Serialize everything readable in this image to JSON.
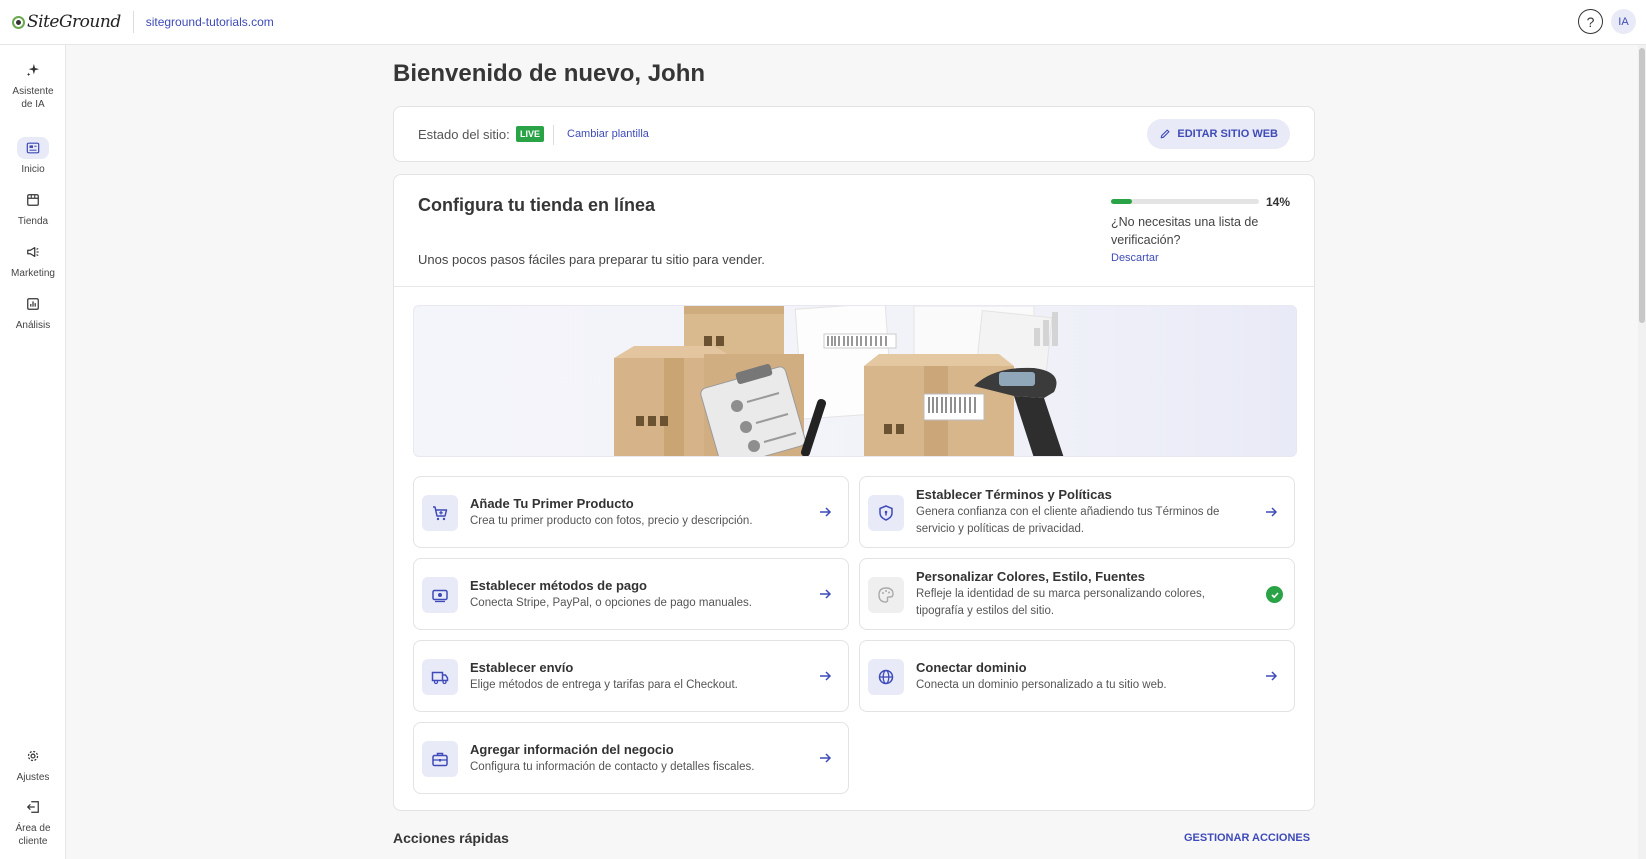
{
  "topbar": {
    "logo_text": "SiteGround",
    "domain": "siteground-tutorials.com",
    "help_label": "?",
    "avatar_initials": "IA"
  },
  "sidebar": {
    "items": [
      {
        "label_line1": "Asistente",
        "label_line2": "de IA",
        "icon": "sparkle-icon"
      },
      {
        "label_line1": "Inicio",
        "label_line2": "",
        "icon": "dashboard-icon",
        "active": true
      },
      {
        "label_line1": "Tienda",
        "label_line2": "",
        "icon": "store-icon"
      },
      {
        "label_line1": "Marketing",
        "label_line2": "",
        "icon": "megaphone-icon"
      },
      {
        "label_line1": "Análisis",
        "label_line2": "",
        "icon": "chart-icon"
      },
      {
        "label_line1": "Ajustes",
        "label_line2": "",
        "icon": "gear-icon"
      },
      {
        "label_line1": "Área de",
        "label_line2": "cliente",
        "icon": "exit-icon"
      }
    ]
  },
  "main": {
    "welcome": "Bienvenido de nuevo, John",
    "status": {
      "label": "Estado del sitio:",
      "badge": "LIVE",
      "change_template": "Cambiar plantilla",
      "edit_button": "EDITAR SITIO WEB"
    },
    "setup": {
      "title": "Configura tu tienda en línea",
      "description": "Unos pocos pasos fáciles para preparar tu sitio para vender.",
      "progress_percent": 14,
      "progress_label": "14%",
      "no_need": "¿No necesitas una lista de verificación?",
      "dismiss": "Descartar",
      "tasks": [
        {
          "title": "Añade Tu Primer Producto",
          "description": "Crea tu primer producto con fotos, precio y descripción.",
          "icon": "cart-icon",
          "done": false
        },
        {
          "title": "Establecer Términos y Políticas",
          "description": "Genera confianza con el cliente añadiendo tus Términos de servicio y políticas de privacidad.",
          "icon": "shield-icon",
          "done": false
        },
        {
          "title": "Establecer métodos de pago",
          "description": "Conecta Stripe, PayPal, o opciones de pago manuales.",
          "icon": "money-icon",
          "done": false
        },
        {
          "title": "Personalizar Colores, Estilo, Fuentes",
          "description": "Refleje la identidad de su marca personalizando colores, tipografía y estilos del sitio.",
          "icon": "palette-icon",
          "done": true
        },
        {
          "title": "Establecer envío",
          "description": "Elige métodos de entrega y tarifas para el Checkout.",
          "icon": "truck-icon",
          "done": false
        },
        {
          "title": "Conectar dominio",
          "description": "Conecta un dominio personalizado a tu sitio web.",
          "icon": "globe-icon",
          "done": false
        },
        {
          "title": "Agregar información del negocio",
          "description": "Configura tu información de contacto y detalles fiscales.",
          "icon": "briefcase-icon",
          "done": false
        }
      ]
    },
    "quick_actions": {
      "title": "Acciones rápidas",
      "manage": "GESTIONAR ACCIONES"
    }
  },
  "colors": {
    "accent": "#3e4bb8",
    "accent_light": "#e9eaf7",
    "success": "#2aa346"
  }
}
